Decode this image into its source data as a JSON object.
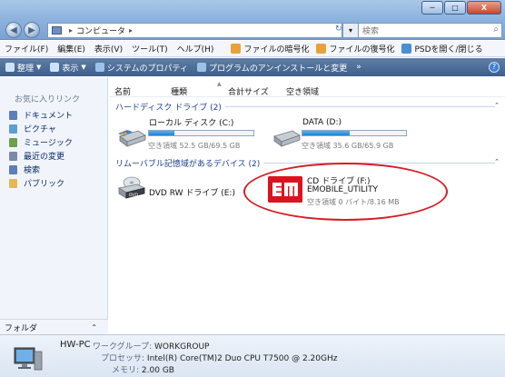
{
  "window": {
    "minimize": "─",
    "maximize": "□",
    "close": "X"
  },
  "address": {
    "path": [
      "コンピュータ"
    ],
    "sep": "▸",
    "refresh": "↻",
    "dropdown": "▾",
    "search_placeholder": "検索",
    "search_icon": "⌕"
  },
  "menu": {
    "items": [
      "ファイル(F)",
      "編集(E)",
      "表示(V)",
      "ツール(T)",
      "ヘルプ(H)"
    ],
    "extras": [
      {
        "label": "ファイルの暗号化",
        "color": "#e8a23a"
      },
      {
        "label": "ファイルの復号化",
        "color": "#e8a23a"
      },
      {
        "label": "PSDを開く/閉じる",
        "color": "#4a90d0"
      }
    ]
  },
  "commands": {
    "items": [
      {
        "label": "整理",
        "dropdown": true,
        "color": "#cfe3f8"
      },
      {
        "label": "表示",
        "dropdown": true,
        "color": "#cfe3f8"
      },
      {
        "label": "システムのプロパティ",
        "dropdown": false,
        "color": "#9cc2ea"
      },
      {
        "label": "プログラムのアンインストールと変更",
        "dropdown": false,
        "color": "#9cc2ea"
      }
    ],
    "overflow": "»",
    "help": "?"
  },
  "nav": {
    "title": "お気に入りリンク",
    "items": [
      {
        "label": "ドキュメント",
        "color": "#5b7fb8"
      },
      {
        "label": "ピクチャ",
        "color": "#5b9fd8"
      },
      {
        "label": "ミュージック",
        "color": "#6fa04a"
      },
      {
        "label": "最近の変更",
        "color": "#7a8aa8"
      },
      {
        "label": "検索",
        "color": "#5b7fb8"
      },
      {
        "label": "パブリック",
        "color": "#e8b84a"
      }
    ],
    "folder": "フォルダ",
    "folder_chevron": "⌃"
  },
  "columns": [
    "名前",
    "種類",
    "合計サイズ",
    "空き領域"
  ],
  "groups": [
    {
      "label": "ハードディスク ドライブ (2)"
    },
    {
      "label": "リムーバブル記憶域があるデバイス (2)"
    }
  ],
  "group_chevron": "⌃",
  "drives": {
    "c": {
      "name": "ローカル ディスク (C:)",
      "free": "空き領域 52.5 GB/69.5 GB",
      "used_fraction": 0.245
    },
    "d": {
      "name": "DATA (D:)",
      "free": "空き領域 35.6 GB/65.9 GB",
      "used_fraction": 0.46
    },
    "e": {
      "name": "DVD RW ドライブ (E:)",
      "badge": "DVD"
    },
    "f": {
      "name": "CD ドライブ (F:)",
      "label": "EMOBILE_UTILITY",
      "free": "空き領域 0 バイト/8.16 MB"
    }
  },
  "details": {
    "computer_name": "HW-PC",
    "workgroup_key": "ワークグループ:",
    "workgroup": "WORKGROUP",
    "processor_key": "プロセッサ:",
    "processor": "Intel(R) Core(TM)2 Duo CPU     T7500  @ 2.20GHz",
    "memory_key": "メモリ:",
    "memory": "2.00 GB"
  },
  "colors": {
    "accent": "#1f80d6",
    "annotation": "#d41e24",
    "emobile_red": "#d9141e"
  }
}
